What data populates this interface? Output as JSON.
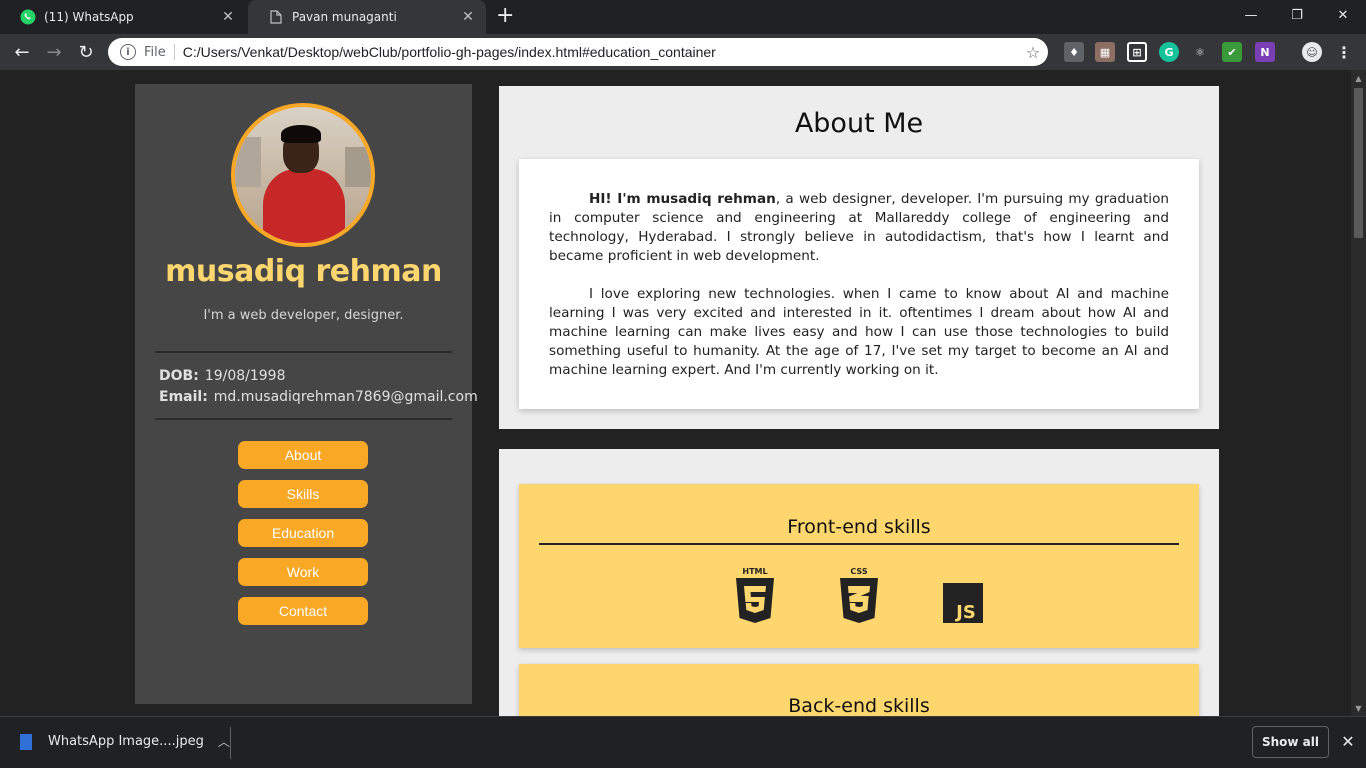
{
  "browser": {
    "tabs": [
      {
        "title": "(11) WhatsApp",
        "icon": "whatsapp-icon",
        "active": false
      },
      {
        "title": "Pavan munaganti",
        "icon": "page-icon",
        "active": true
      }
    ],
    "new_tab_label": "+",
    "omnibox": {
      "scheme_label": "File",
      "url": "C:/Users/Venkat/Desktop/webClub/portfolio-gh-pages/index.html#education_container"
    }
  },
  "profile": {
    "name": "musadiq rehman",
    "tagline": "I'm a web developer, designer.",
    "dob_label": "DOB:",
    "dob": "19/08/1998",
    "email_label": "Email:",
    "email": "md.musadiqrehman7869@gmail.com"
  },
  "nav": [
    {
      "label": "About"
    },
    {
      "label": "Skills"
    },
    {
      "label": "Education"
    },
    {
      "label": "Work"
    },
    {
      "label": "Contact"
    }
  ],
  "about": {
    "title": "About Me",
    "intro_bold": "HI! I'm musadiq rehman",
    "intro_rest": ", a web designer, developer. I'm pursuing my graduation in computer science and engineering at Mallareddy college of engineering and technology, Hyderabad. I strongly believe in autodidactism, that's how I learnt and became proficient in web development.",
    "paragraph2": "I love exploring new technologies. when I came to know about AI and machine learning I was very excited and interested in it. oftentimes I dream about how AI and machine learning can make lives easy and how I can use those technologies to build something useful to humanity. At the age of 17, I've set my target to become an AI and machine learning expert. And I'm currently working on it."
  },
  "skills": {
    "frontend_title": "Front-end skills",
    "frontend_icons": [
      {
        "label": "HTML",
        "icon": "html5-icon"
      },
      {
        "label": "CSS",
        "icon": "css3-icon"
      },
      {
        "label": "JS",
        "icon": "js-icon"
      }
    ],
    "backend_title": "Back-end skills"
  },
  "downloads": {
    "file_name": "WhatsApp Image....jpeg",
    "show_all_label": "Show all"
  },
  "colors": {
    "accent": "#f9a825",
    "name_yellow": "#fdd66e",
    "sidebar_bg": "#464646",
    "skill_card_bg": "#fdd66e"
  }
}
